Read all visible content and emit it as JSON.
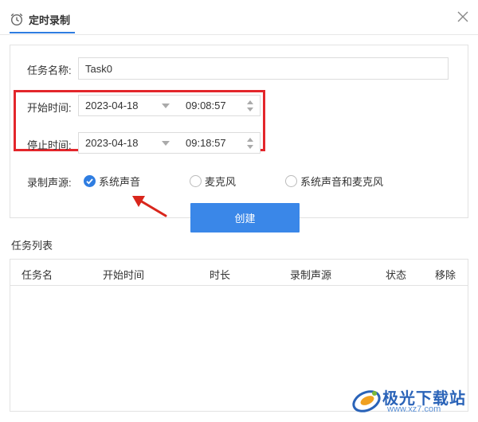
{
  "dialog": {
    "title": "定时录制"
  },
  "form": {
    "task_name_label": "任务名称:",
    "task_name_value": "Task0",
    "start_label": "开始时间:",
    "start_date": "2023-04-18",
    "start_time": "09:08:57",
    "stop_label": "停止时间:",
    "stop_date": "2023-04-18",
    "stop_time": "09:18:57",
    "source_label": "录制声源:",
    "sources": [
      {
        "label": "系统声音",
        "checked": true
      },
      {
        "label": "麦克风",
        "checked": false
      },
      {
        "label": "系统声音和麦克风",
        "checked": false
      }
    ],
    "create_label": "创建"
  },
  "task_list": {
    "title": "任务列表",
    "columns": [
      "任务名",
      "开始时间",
      "时长",
      "录制声源",
      "状态",
      "移除"
    ]
  },
  "watermark": {
    "brand": "极光下载站",
    "url": "www.xz7.com"
  },
  "colors": {
    "accent": "#3a87e8",
    "highlight": "#e3262b",
    "annotation_arrow": "#d9261c"
  }
}
